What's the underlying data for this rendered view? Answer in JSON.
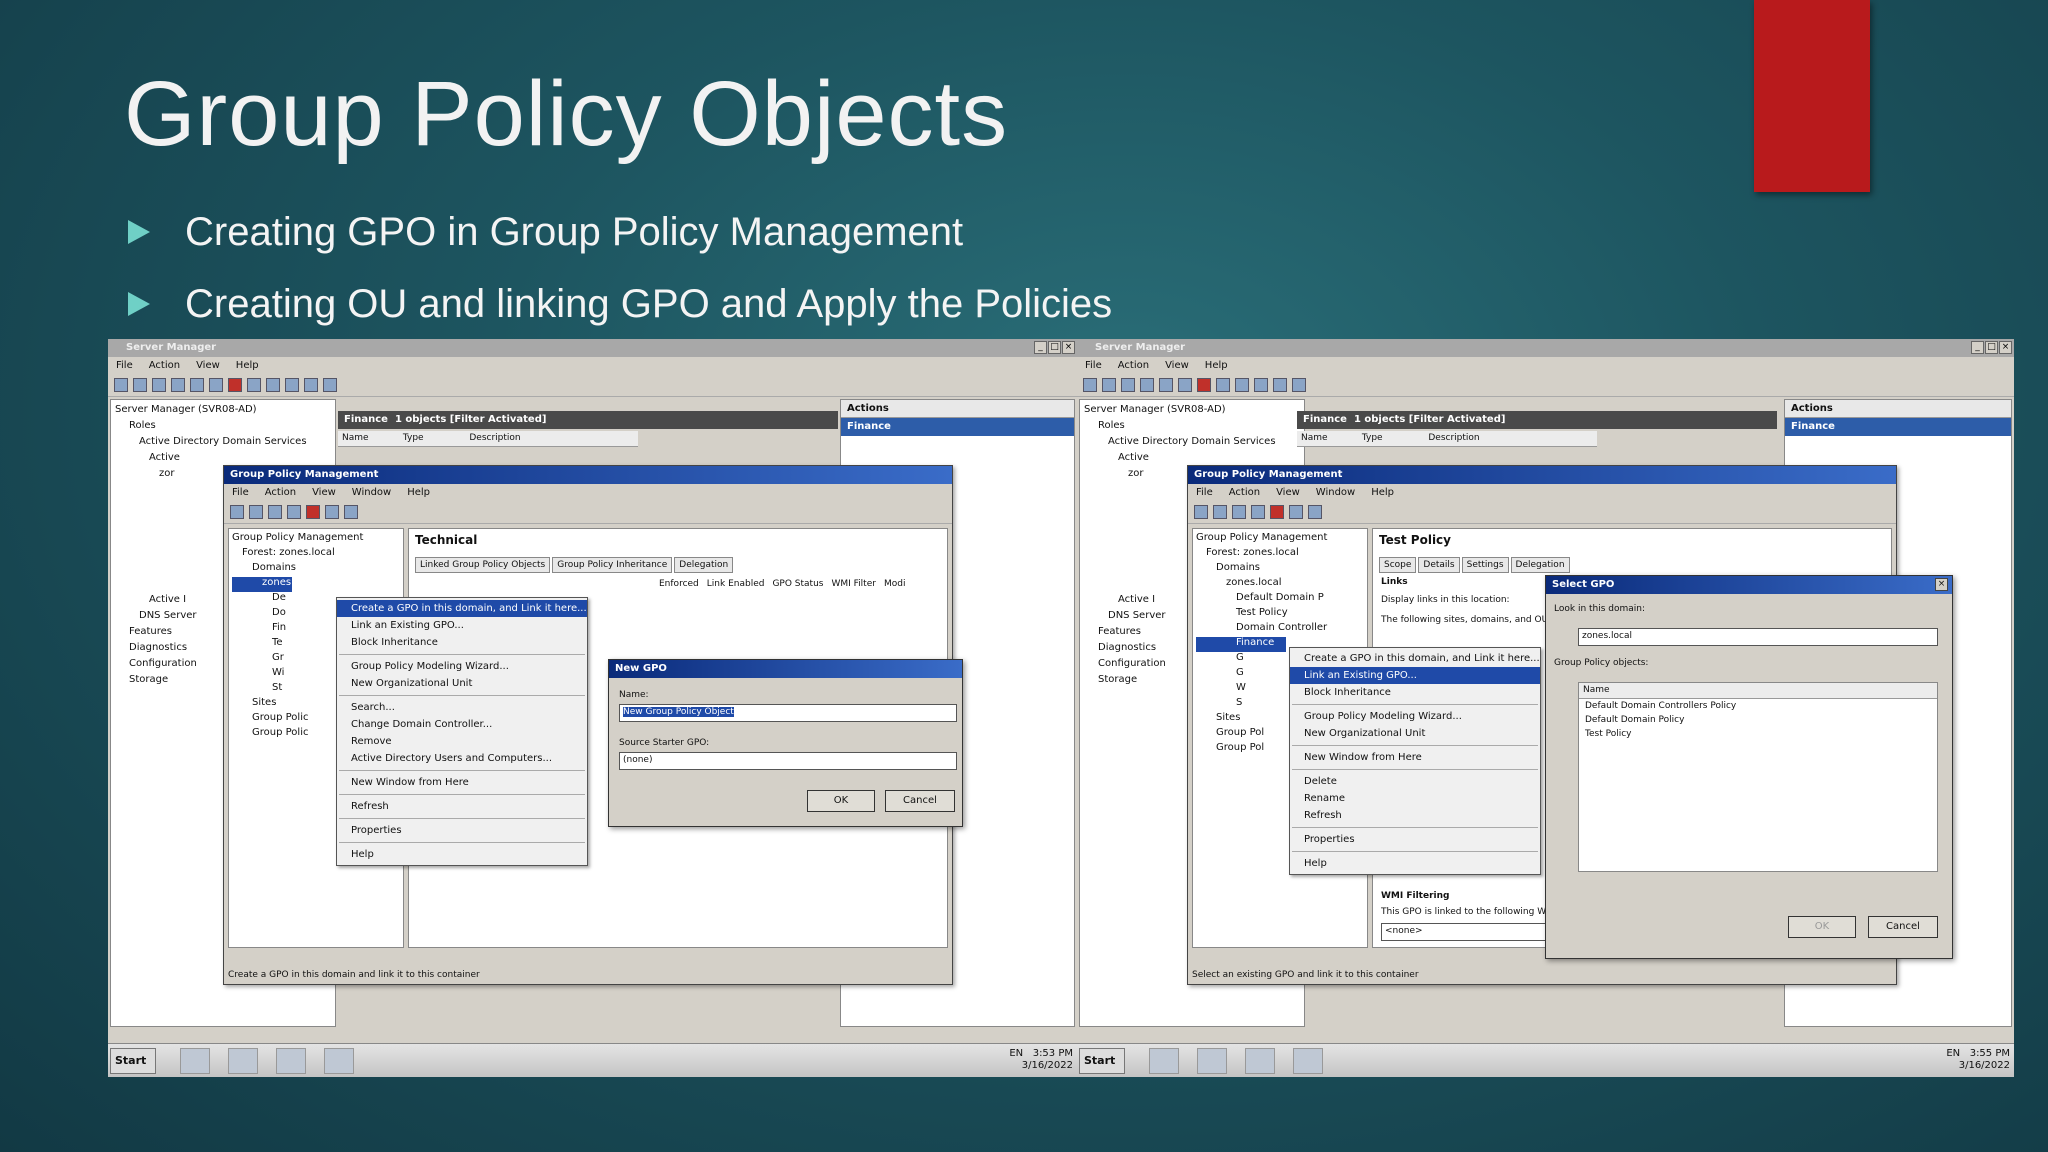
{
  "slide": {
    "title": "Group Policy Objects",
    "bullets": [
      "Creating GPO in Group Policy Management",
      "Creating OU and linking GPO and Apply the Policies"
    ],
    "accent_color": "#b81a1c"
  },
  "left": {
    "window_title": "Server Manager",
    "menu": [
      "File",
      "Action",
      "View",
      "Help"
    ],
    "tree": [
      "Server Manager (SVR08-AD)",
      "Roles",
      "Active Directory Domain Services",
      "Active",
      "zor",
      "Active I",
      "DNS Server",
      "Features",
      "Diagnostics",
      "Configuration",
      "Storage"
    ],
    "finance_header": "Finance",
    "finance_count": "1 objects",
    "finance_filter": "[Filter Activated]",
    "columns": [
      "Name",
      "Type",
      "Description"
    ],
    "actions_title": "Actions",
    "actions_item": "Finance",
    "gpm": {
      "title": "Group Policy Management",
      "menu": [
        "File",
        "Action",
        "View",
        "Window",
        "Help"
      ],
      "tree": [
        "Group Policy Management",
        "Forest: zones.local",
        "Domains",
        "zones.local",
        "De",
        "Do",
        "Fin",
        "Te",
        "Gr",
        "Wi",
        "St",
        "Sites",
        "Group Polic",
        "Group Polic"
      ],
      "detail_title": "Technical",
      "tabs": [
        "Linked Group Policy Objects",
        "Group Policy Inheritance",
        "Delegation"
      ],
      "grid_columns": [
        "Enforced",
        "Link Enabled",
        "GPO Status",
        "WMI Filter",
        "Modi"
      ],
      "status": "Create a GPO in this domain and link it to this container"
    },
    "context_menu": [
      "Create a GPO in this domain, and Link it here...",
      "Link an Existing GPO...",
      "Block Inheritance",
      "-",
      "Group Policy Modeling Wizard...",
      "New Organizational Unit",
      "-",
      "Search...",
      "Change Domain Controller...",
      "Remove",
      "Active Directory Users and Computers...",
      "-",
      "New Window from Here",
      "-",
      "Refresh",
      "-",
      "Properties",
      "-",
      "Help"
    ],
    "new_gpo": {
      "title": "New GPO",
      "name_label": "Name:",
      "name_value": "New Group Policy Object",
      "starter_label": "Source Starter GPO:",
      "starter_value": "(none)",
      "ok": "OK",
      "cancel": "Cancel"
    },
    "taskbar": {
      "start": "Start",
      "lang": "EN",
      "time": "3:53 PM",
      "date": "3/16/2022"
    }
  },
  "right": {
    "window_title": "Server Manager",
    "menu": [
      "File",
      "Action",
      "View",
      "Help"
    ],
    "tree": [
      "Server Manager (SVR08-AD)",
      "Roles",
      "Active Directory Domain Services",
      "Active",
      "zor",
      "Active I",
      "DNS Server",
      "Features",
      "Diagnostics",
      "Configuration",
      "Storage"
    ],
    "finance_header": "Finance",
    "finance_count": "1 objects",
    "finance_filter": "[Filter Activated]",
    "columns": [
      "Name",
      "Type",
      "Description"
    ],
    "actions_title": "Actions",
    "actions_item": "Finance",
    "gpm": {
      "title": "Group Policy Management",
      "menu": [
        "File",
        "Action",
        "View",
        "Window",
        "Help"
      ],
      "tree": [
        "Group Policy Management",
        "Forest: zones.local",
        "Domains",
        "zones.local",
        "Default Domain P",
        "Test Policy",
        "Domain Controller",
        "Finance",
        "G",
        "G",
        "W",
        "S",
        "Sites",
        "Group Pol",
        "Group Pol"
      ],
      "detail_title": "Test Policy",
      "tabs": [
        "Scope",
        "Details",
        "Settings",
        "Delegation"
      ],
      "links_label": "Links",
      "display_links": "Display links in this location:",
      "following_sites": "The following sites, domains, and OUs",
      "wmi_label": "WMI Filtering",
      "wmi_text": "This GPO is linked to the following WMI",
      "wmi_value": "<none>",
      "status": "Select an existing GPO and link it to this container"
    },
    "context_menu": [
      "Create a GPO in this domain, and Link it here...",
      "Link an Existing GPO...",
      "Block Inheritance",
      "-",
      "Group Policy Modeling Wizard...",
      "New Organizational Unit",
      "-",
      "New Window from Here",
      "-",
      "Delete",
      "Rename",
      "Refresh",
      "-",
      "Properties",
      "-",
      "Help"
    ],
    "select_gpo": {
      "title": "Select GPO",
      "look_in": "Look in this domain:",
      "domain": "zones.local",
      "objects_label": "Group Policy objects:",
      "column": "Name",
      "items": [
        "Default Domain Controllers Policy",
        "Default Domain Policy",
        "Test Policy"
      ],
      "ok": "OK",
      "cancel": "Cancel"
    },
    "taskbar": {
      "start": "Start",
      "lang": "EN",
      "time": "3:55 PM",
      "date": "3/16/2022"
    }
  }
}
